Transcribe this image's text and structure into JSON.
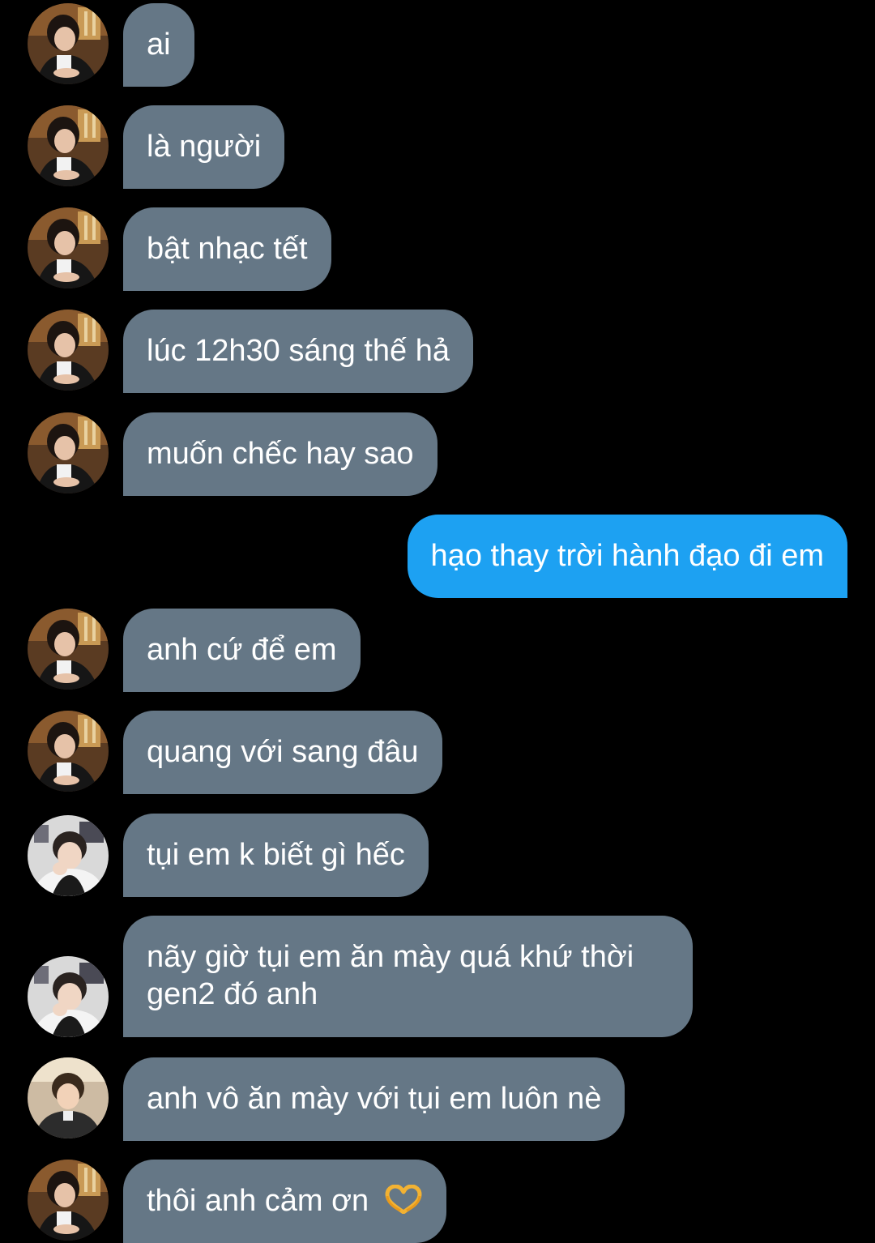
{
  "conversation": {
    "messages": [
      {
        "id": "m1",
        "direction": "incoming",
        "avatar": "avatar-a",
        "text": "ai"
      },
      {
        "id": "m2",
        "direction": "incoming",
        "avatar": "avatar-a",
        "text": "là người"
      },
      {
        "id": "m3",
        "direction": "incoming",
        "avatar": "avatar-a",
        "text": "bật nhạc tết"
      },
      {
        "id": "m4",
        "direction": "incoming",
        "avatar": "avatar-a",
        "text": "lúc 12h30 sáng thế hả"
      },
      {
        "id": "m5",
        "direction": "incoming",
        "avatar": "avatar-a",
        "text": "muốn chếc hay sao"
      },
      {
        "id": "m6",
        "direction": "outgoing",
        "avatar": "",
        "text": "hạo thay trời hành đạo đi em"
      },
      {
        "id": "m7",
        "direction": "incoming",
        "avatar": "avatar-a",
        "text": "anh cứ để em"
      },
      {
        "id": "m8",
        "direction": "incoming",
        "avatar": "avatar-a",
        "text": "quang với sang đâu"
      },
      {
        "id": "m9",
        "direction": "incoming",
        "avatar": "avatar-b",
        "text": "tụi em k biết gì hếc"
      },
      {
        "id": "m10",
        "direction": "incoming",
        "avatar": "avatar-b",
        "text": "nãy giờ tụi em ăn mày quá khứ thời gen2 đó anh"
      },
      {
        "id": "m11",
        "direction": "incoming",
        "avatar": "avatar-c",
        "text": "anh vô ăn mày với tụi em luôn nè"
      },
      {
        "id": "m12",
        "direction": "incoming",
        "avatar": "avatar-a",
        "text": "thôi anh cảm ơn",
        "emoji": "heart-hands-emoji"
      }
    ]
  },
  "colors": {
    "background": "#000000",
    "incoming_bubble": "#657786",
    "outgoing_bubble": "#1da1f2",
    "text": "#ffffff"
  }
}
